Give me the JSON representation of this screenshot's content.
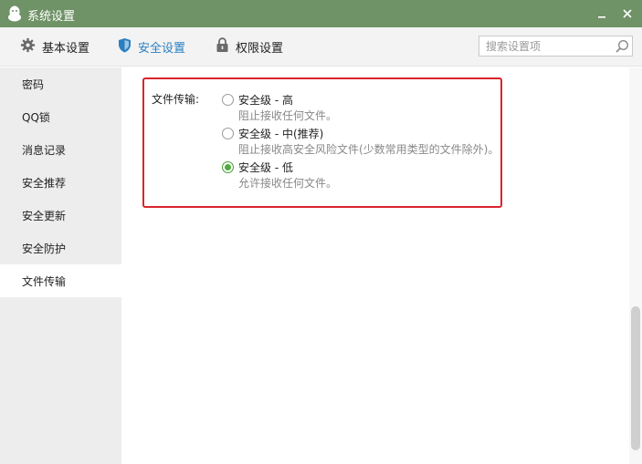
{
  "window": {
    "title": "系统设置"
  },
  "tabs": [
    {
      "label": "基本设置",
      "icon": "gear-icon"
    },
    {
      "label": "安全设置",
      "icon": "shield-icon",
      "active": true
    },
    {
      "label": "权限设置",
      "icon": "lock-icon"
    }
  ],
  "search": {
    "placeholder": "搜索设置项"
  },
  "sidebar": {
    "items": [
      {
        "label": "密码"
      },
      {
        "label": "QQ锁"
      },
      {
        "label": "消息记录"
      },
      {
        "label": "安全推荐"
      },
      {
        "label": "安全更新"
      },
      {
        "label": "安全防护"
      },
      {
        "label": "文件传输",
        "active": true
      }
    ]
  },
  "file_transfer": {
    "label": "文件传输:",
    "options": [
      {
        "label": "安全级 - 高",
        "desc": "阻止接收任何文件。",
        "checked": false
      },
      {
        "label": "安全级 - 中(推荐)",
        "desc": "阻止接收高安全风险文件(少数常用类型的文件除外)。",
        "checked": false
      },
      {
        "label": "安全级 - 低",
        "desc": "允许接收任何文件。",
        "checked": true
      }
    ]
  },
  "colors": {
    "titlebar": "#6f9266",
    "active_tab": "#2a7fc1",
    "highlight": "#d9242c",
    "radio_checked": "#4cae3a"
  }
}
